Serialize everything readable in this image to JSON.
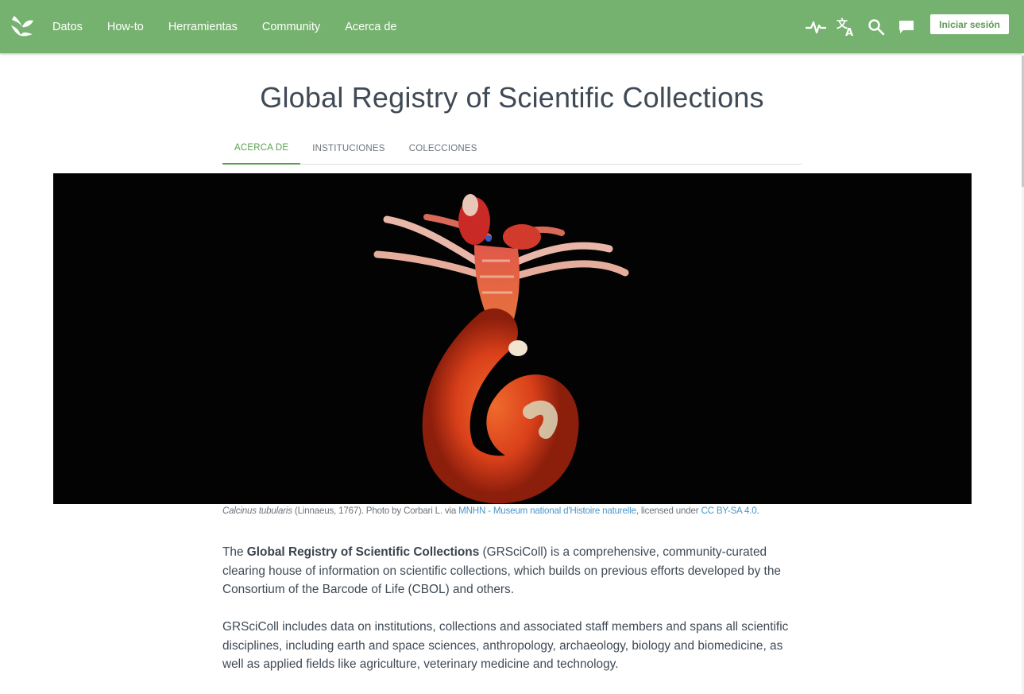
{
  "nav": {
    "links": [
      "Datos",
      "How-to",
      "Herramientas",
      "Community",
      "Acerca de"
    ],
    "icons": [
      "pulse-icon",
      "translate-icon",
      "search-icon",
      "feedback-icon"
    ],
    "login_label": "Iniciar sesión",
    "brand_color": "#76b26f"
  },
  "page": {
    "title": "Global Registry of Scientific Collections",
    "tabs": [
      "Acerca de",
      "Instituciones",
      "Colecciones"
    ],
    "active_tab": "Acerca de",
    "accent_color": "#5aa04f"
  },
  "hero": {
    "caption": {
      "species": "Calcinus tubularis",
      "author_text": " (Linnaeus, 1767). Photo by Corbari L. via ",
      "source_link": "MNHN - Museum national d'Histoire naturelle",
      "license_prefix": ", licensed under ",
      "license_link": "CC BY-SA 4.0",
      "suffix": "."
    }
  },
  "content": {
    "p1": {
      "lead": "The ",
      "bold": "Global Registry of Scientific Collections",
      "rest": " (GRSciColl) is a comprehensive, community-curated clearing house of information on scientific collections, which builds on previous efforts developed by the Consortium of the Barcode of Life (CBOL) and others."
    },
    "p2": "GRSciColl includes data on institutions, collections and associated staff members and spans all scientific disciplines, including earth and space sciences, anthropology, archaeology, biology and biomedicine, as well as applied fields like agriculture, veterinary medicine and technology."
  }
}
